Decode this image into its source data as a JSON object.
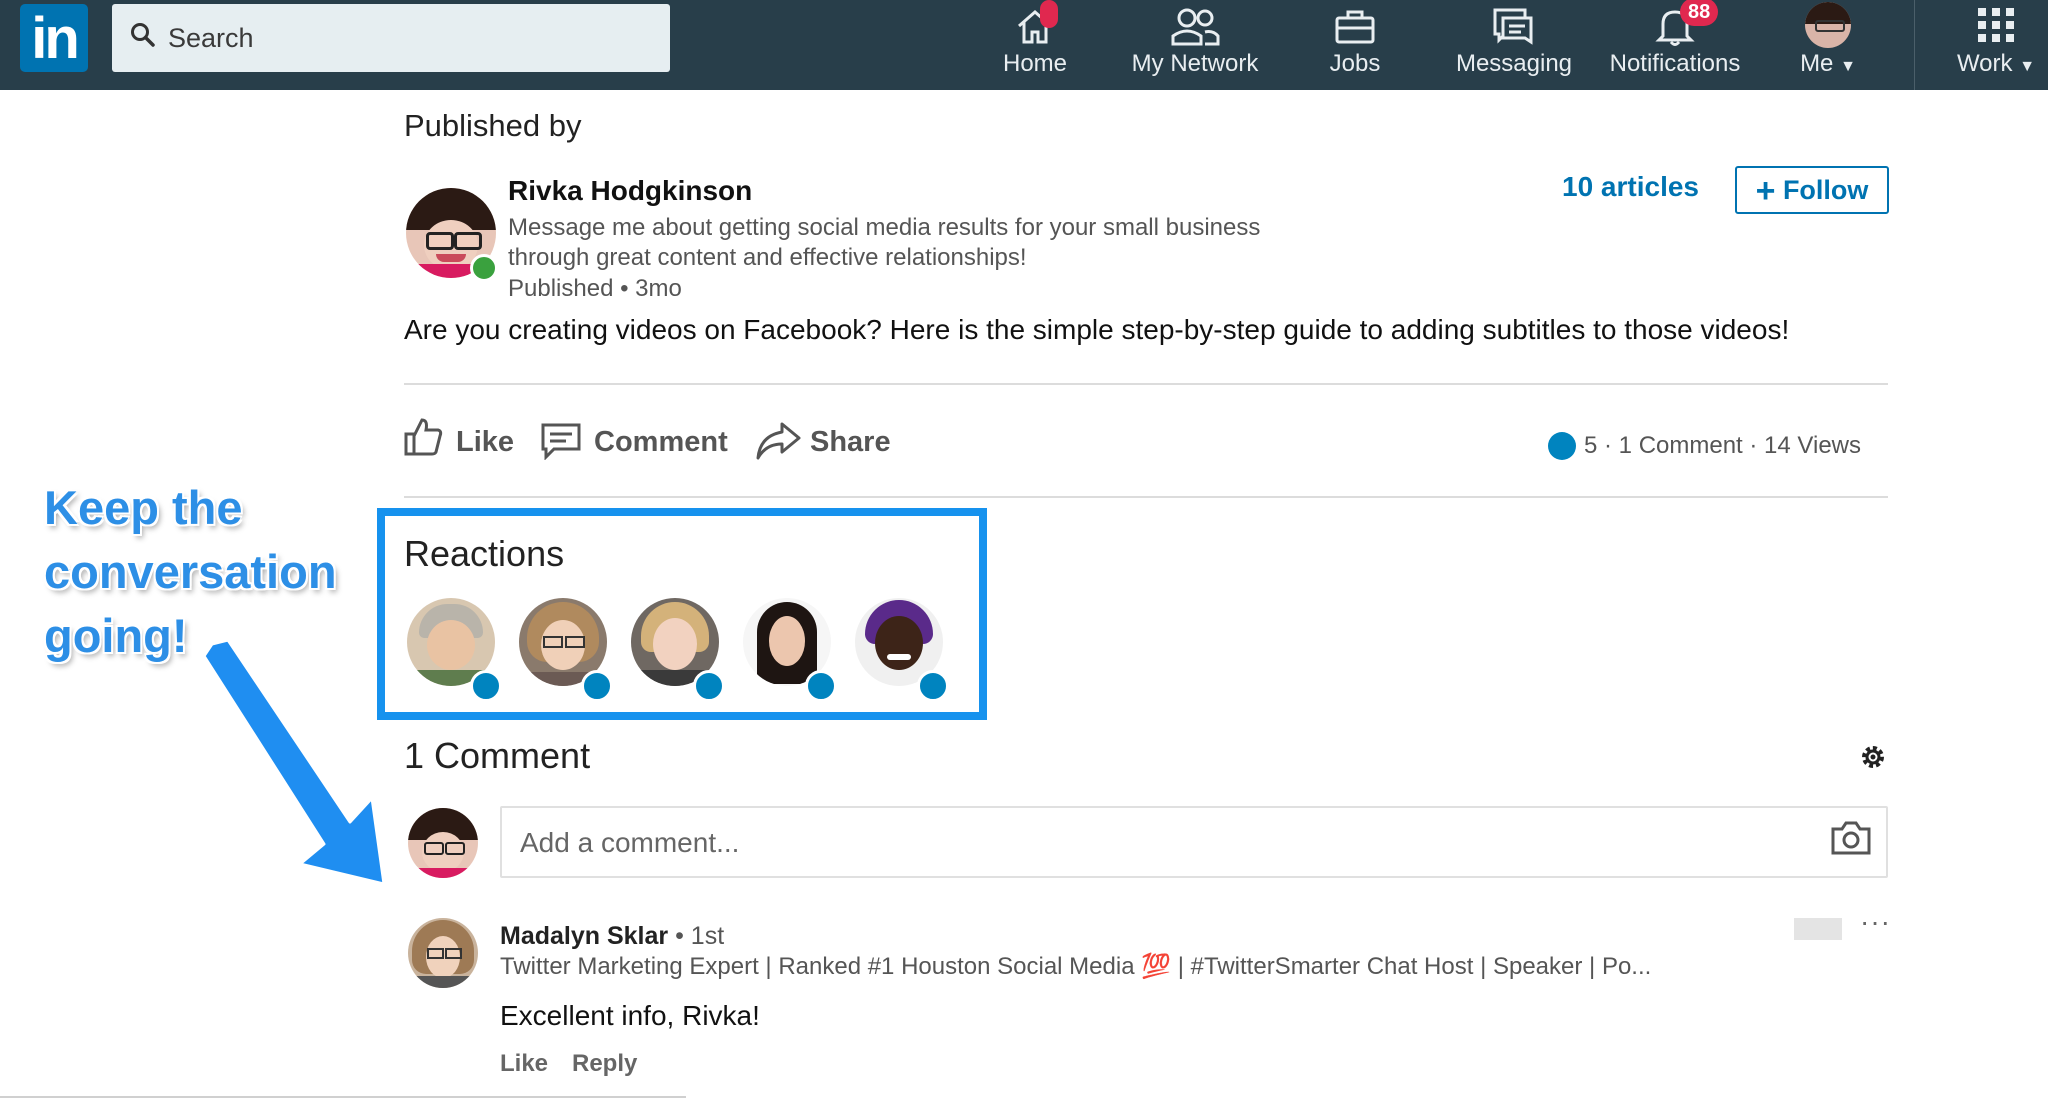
{
  "nav": {
    "logo": "in",
    "search_placeholder": "Search",
    "items": [
      {
        "label": "Home",
        "icon": "home-icon"
      },
      {
        "label": "My Network",
        "icon": "network-icon"
      },
      {
        "label": "Jobs",
        "icon": "briefcase-icon"
      },
      {
        "label": "Messaging",
        "icon": "messaging-icon"
      },
      {
        "label": "Notifications",
        "icon": "bell-icon",
        "badge": "88"
      },
      {
        "label": "Me",
        "icon": "avatar"
      },
      {
        "label": "Work",
        "icon": "grid-icon"
      }
    ]
  },
  "article": {
    "published_by": "Published by",
    "author_name": "Rivka Hodgkinson",
    "author_headline": "Message me about getting social media results for your small business through great content and effective relationships!",
    "published_meta": "Published • 3mo",
    "articles_link": "10 articles",
    "follow_label": "Follow",
    "post_text": "Are you creating videos on Facebook? Here is the simple step-by-step guide to adding subtitles to those videos!"
  },
  "actions": {
    "like": "Like",
    "comment": "Comment",
    "share": "Share",
    "stats": "5 · 1 Comment · 14 Views"
  },
  "reactions": {
    "title": "Reactions"
  },
  "annotation": {
    "text": "Keep the conversation going!"
  },
  "comments": {
    "count_label": "1 Comment",
    "placeholder": "Add a comment...",
    "items": [
      {
        "name": "Madalyn Sklar",
        "degree": " • 1st",
        "headline": "Twitter Marketing Expert | Ranked #1 Houston Social Media 💯 | #TwitterSmarter Chat Host | Speaker | Po...",
        "text": "Excellent info, Rivka!",
        "like": "Like",
        "reply": "Reply"
      }
    ]
  },
  "colors": {
    "nav_bg": "#283e4a",
    "brand_blue": "#0073b1",
    "highlight_blue": "#1692ee",
    "badge_red": "#e0284f"
  }
}
